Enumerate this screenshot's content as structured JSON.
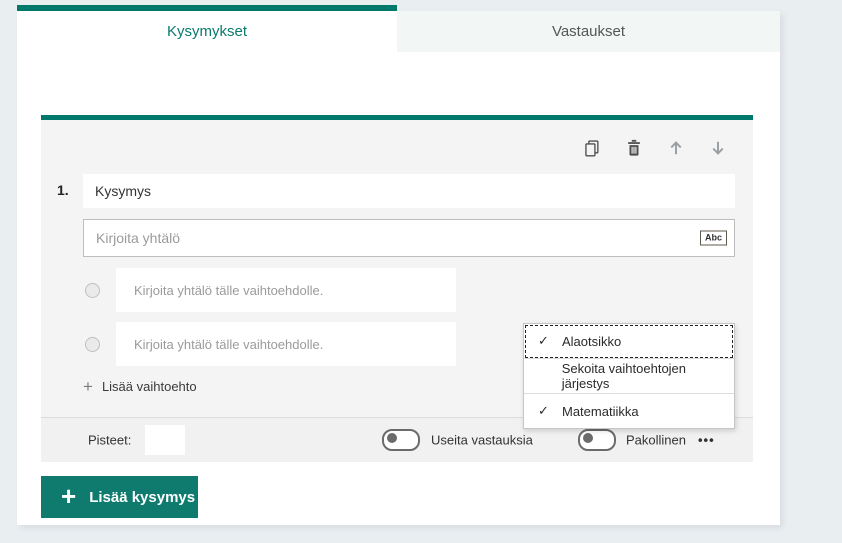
{
  "colors": {
    "accent_teal": "#00786b",
    "button_teal": "#0e7b6e",
    "active_tab_text": "#0a7a6e",
    "page_background": "#e9eef1",
    "card_background": "#f4f4f4"
  },
  "tabs": {
    "questions": {
      "label": "Kysymykset",
      "active": true
    },
    "answers": {
      "label": "Vastaukset",
      "active": false
    }
  },
  "question": {
    "number": "1.",
    "title_value": "Kysymys",
    "equation_placeholder": "Kirjoita yhtälö",
    "equation_tool_label": "Abc",
    "options": [
      {
        "placeholder": "Kirjoita yhtälö tälle vaihtoehdolle."
      },
      {
        "placeholder": "Kirjoita yhtälö tälle vaihtoehdolle."
      }
    ],
    "add_option": {
      "plus_glyph": "+",
      "label": "Lisää vaihtoehto"
    }
  },
  "toolbar_icons": [
    {
      "name": "copy-icon"
    },
    {
      "name": "delete-icon"
    },
    {
      "name": "move-up-icon",
      "disabled": true
    },
    {
      "name": "move-down-icon",
      "disabled": true
    }
  ],
  "context_menu": {
    "items": [
      {
        "label": "Alaotsikko",
        "check_glyph": "✓",
        "checked": true,
        "focused": true
      },
      {
        "label": "Sekoita vaihtoehtojen järjestys",
        "checked": false
      },
      {
        "label": "Matematiikka",
        "check_glyph": "✓",
        "checked": true
      }
    ]
  },
  "footer": {
    "points_label": "Pisteet:",
    "points_value": "",
    "toggles": [
      {
        "label": "Useita vastauksia",
        "on": false
      },
      {
        "label": "Pakollinen",
        "on": false
      }
    ],
    "more_options_glyph": "•••"
  },
  "add_question": {
    "plus_glyph": "+",
    "label": "Lisää kysymys"
  }
}
